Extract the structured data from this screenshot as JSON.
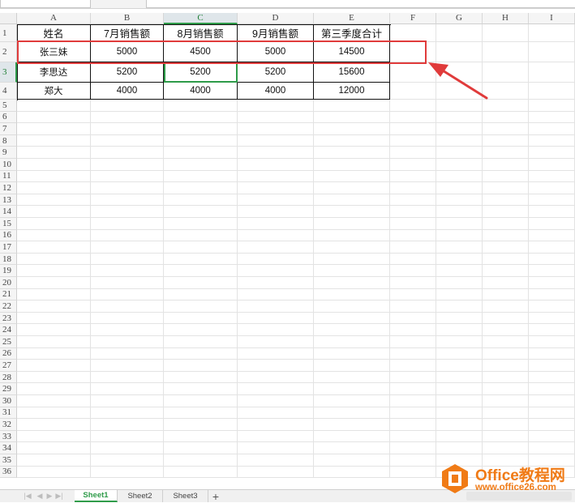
{
  "columns": [
    "A",
    "B",
    "C",
    "D",
    "E",
    "F",
    "G",
    "H",
    "I"
  ],
  "selected_column": "C",
  "rows": [
    "1",
    "2",
    "3",
    "4",
    "5",
    "6",
    "7",
    "8",
    "9",
    "10",
    "11",
    "12",
    "13",
    "14",
    "15",
    "16",
    "17",
    "18",
    "19",
    "20",
    "21",
    "22",
    "23",
    "24",
    "25",
    "26",
    "27",
    "28",
    "29",
    "30",
    "31",
    "32",
    "33",
    "34",
    "35",
    "36"
  ],
  "selected_row": "3",
  "table": {
    "headers": [
      "姓名",
      "7月销售额",
      "8月销售额",
      "9月销售额",
      "第三季度合计"
    ],
    "data": [
      [
        "张三妹",
        "5000",
        "4500",
        "5000",
        "14500"
      ],
      [
        "李思达",
        "5200",
        "5200",
        "5200",
        "15600"
      ],
      [
        "郑大",
        "4000",
        "4000",
        "4000",
        "12000"
      ]
    ]
  },
  "sheet_tabs": [
    "Sheet1",
    "Sheet2",
    "Sheet3"
  ],
  "active_sheet": "Sheet1",
  "add_sheet_label": "+",
  "watermark": {
    "title": "Office教程网",
    "url": "www.office26.com"
  },
  "colors": {
    "selection_green": "#2e9b49",
    "annotation_red": "#e03b3b",
    "watermark_orange": "#f07b16"
  }
}
